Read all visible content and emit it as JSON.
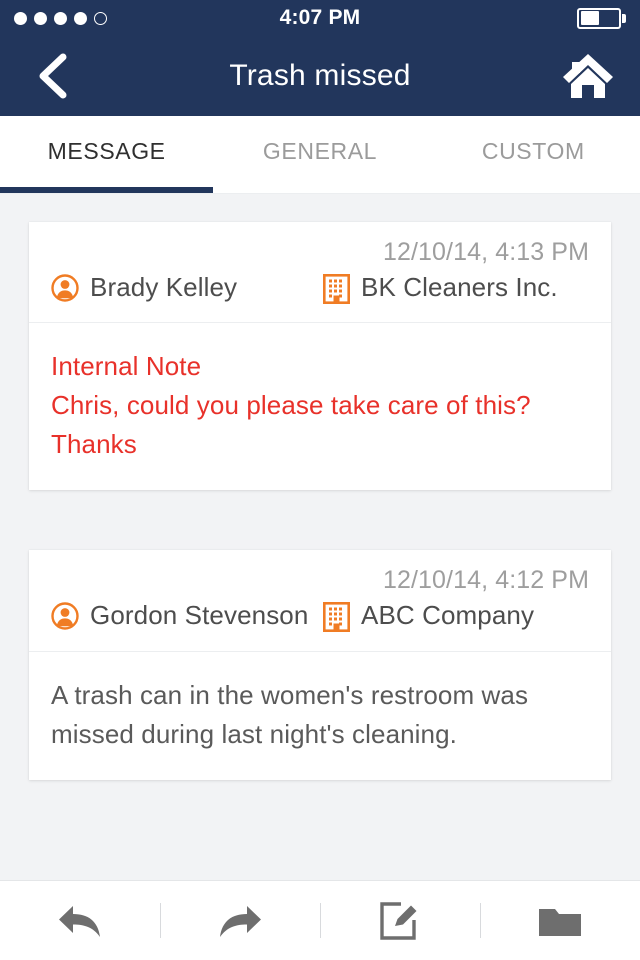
{
  "status_bar": {
    "signal_dots_total": 5,
    "signal_dots_filled": 4,
    "time": "4:07 PM",
    "battery_level_percent": 50
  },
  "nav_bar": {
    "back_icon": "chevron-left-icon",
    "title": "Trash missed",
    "home_icon": "home-icon"
  },
  "tabs": [
    {
      "label": "MESSAGE",
      "active": true
    },
    {
      "label": "GENERAL",
      "active": false
    },
    {
      "label": "CUSTOM",
      "active": false
    }
  ],
  "messages": [
    {
      "date": "12/10/14, 4:13 PM",
      "person_icon": "person-icon",
      "person": "Brady Kelley",
      "company_icon": "building-icon",
      "company": "BK Cleaners Inc.",
      "body": "Internal Note\nChris, could you please take care of this? Thanks",
      "is_internal_note": true
    },
    {
      "date": "12/10/14, 4:12 PM",
      "person_icon": "person-icon",
      "person": "Gordon Stevenson",
      "company_icon": "building-icon",
      "company": "ABC Company",
      "body": "A trash can in the women's restroom was missed during last night's cleaning.",
      "is_internal_note": false
    }
  ],
  "toolbar": [
    {
      "name": "reply-button",
      "icon": "reply-arrow-icon"
    },
    {
      "name": "forward-button",
      "icon": "forward-arrow-icon"
    },
    {
      "name": "compose-button",
      "icon": "compose-edit-icon"
    },
    {
      "name": "folder-button",
      "icon": "folder-icon"
    }
  ],
  "colors": {
    "navy": "#22365c",
    "orange": "#f07c24",
    "note_red": "#e8312a",
    "page_bg": "#f2f3f5",
    "toolbar_icon": "#6e6e6e"
  }
}
